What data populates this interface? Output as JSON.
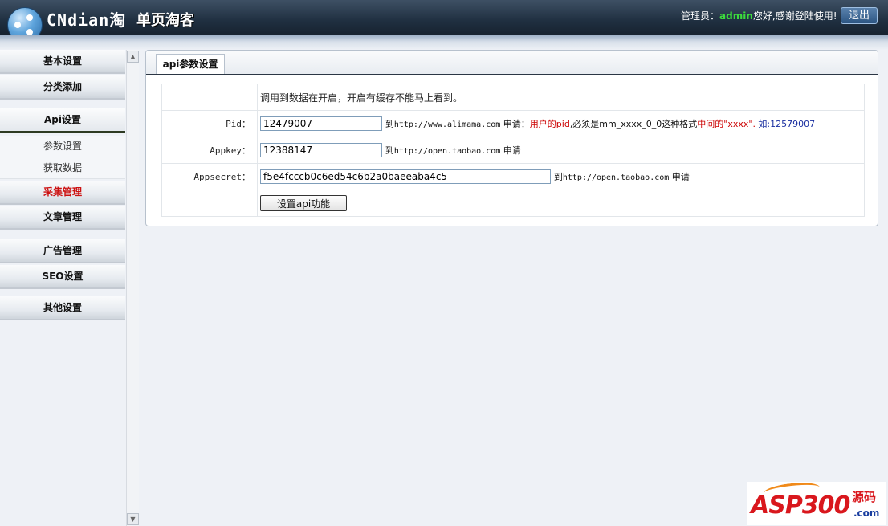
{
  "header": {
    "logo_text": "CNdian淘",
    "logo_sub": "单页淘客",
    "admin_label": "管理员：",
    "admin_name": "admin",
    "greeting": "您好,感谢登陆使用!",
    "logout_label": "退出"
  },
  "sidebar": {
    "items": [
      {
        "label": "基本设置"
      },
      {
        "label": "分类添加"
      },
      {
        "label": "Api设置"
      },
      {
        "label": "参数设置"
      },
      {
        "label": "获取数据"
      },
      {
        "label": "采集管理"
      },
      {
        "label": "文章管理"
      },
      {
        "label": "广告管理"
      },
      {
        "label": "SEO设置"
      },
      {
        "label": "其他设置"
      }
    ]
  },
  "panel": {
    "tab_label": "api参数设置",
    "notice": "调用到数据在开启，开启有缓存不能马上看到。",
    "rows": [
      {
        "label": "Pid：",
        "value": "12479007",
        "hint_prefix": "到",
        "hint_url": "http://www.alimama.com",
        "hint_apply": " 申请：",
        "hint_red1": "用户的pid",
        "hint_mid": ",必须是mm_xxxx_0_0这种格式",
        "hint_red2": "中间的\"xxxx\".",
        "hint_blue": " 如:12579007"
      },
      {
        "label": "Appkey：",
        "value": "12388147",
        "hint_prefix": "到",
        "hint_url": "http://open.taobao.com",
        "hint_apply": " 申请"
      },
      {
        "label": "Appsecret：",
        "value": "f5e4fcccb0c6ed54c6b2a0baeeaba4c5",
        "hint_prefix": "到",
        "hint_url": "http://open.taobao.com",
        "hint_apply": " 申请"
      }
    ],
    "submit_label": "设置api功能"
  },
  "watermark": {
    "main": "ASP300",
    "side": "源码",
    "com": ".com"
  },
  "colors": {
    "accent_red": "#cc1111",
    "admin_green": "#3ddc3d",
    "header_dark": "#1f2f40"
  }
}
